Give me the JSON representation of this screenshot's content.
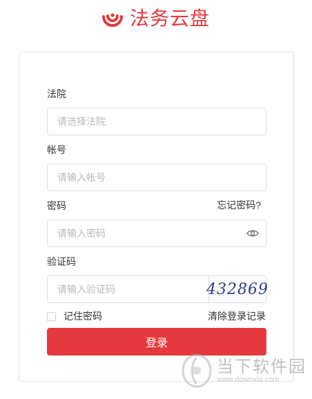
{
  "header": {
    "logo_text": "法务云盘"
  },
  "form": {
    "court_label": "法院",
    "court_placeholder": "请选择法院",
    "account_label": "帐号",
    "account_placeholder": "请输入帐号",
    "password_label": "密码",
    "forgot_password": "忘记密码?",
    "password_placeholder": "请输入密码",
    "captcha_label": "验证码",
    "captcha_placeholder": "请输入验证码",
    "captcha_code": "432869",
    "remember_label": "记住密码",
    "clear_records": "清除登录记录",
    "login_button": "登录"
  },
  "watermark": {
    "title": "当下软件园",
    "url": "www.downxia.com"
  },
  "colors": {
    "accent": "#e5393f"
  },
  "icons": {
    "logo": "logo-icon",
    "eye": "eye-icon",
    "watermark": "watermark-logo-icon"
  }
}
